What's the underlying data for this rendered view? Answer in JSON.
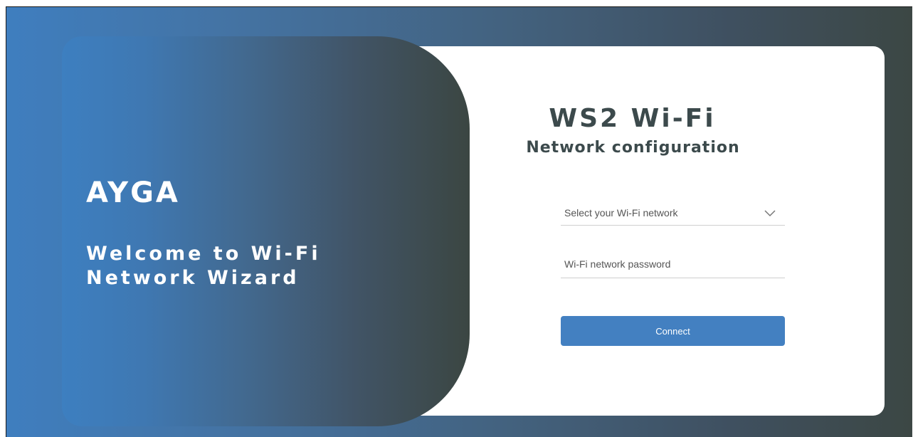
{
  "hero": {
    "brand": "AYGA",
    "welcome_line1": "Welcome to Wi-Fi",
    "welcome_line2": "Network Wizard"
  },
  "form": {
    "title": "WS2 Wi-Fi",
    "subtitle": "Network configuration",
    "network_select": {
      "selected_label": "Select your Wi-Fi network",
      "icon": "chevron-down-icon"
    },
    "password": {
      "value": "",
      "placeholder": "Wi-Fi network password"
    },
    "connect_label": "Connect"
  },
  "colors": {
    "accent": "#4380c1",
    "title_text": "#3c4a4c"
  }
}
